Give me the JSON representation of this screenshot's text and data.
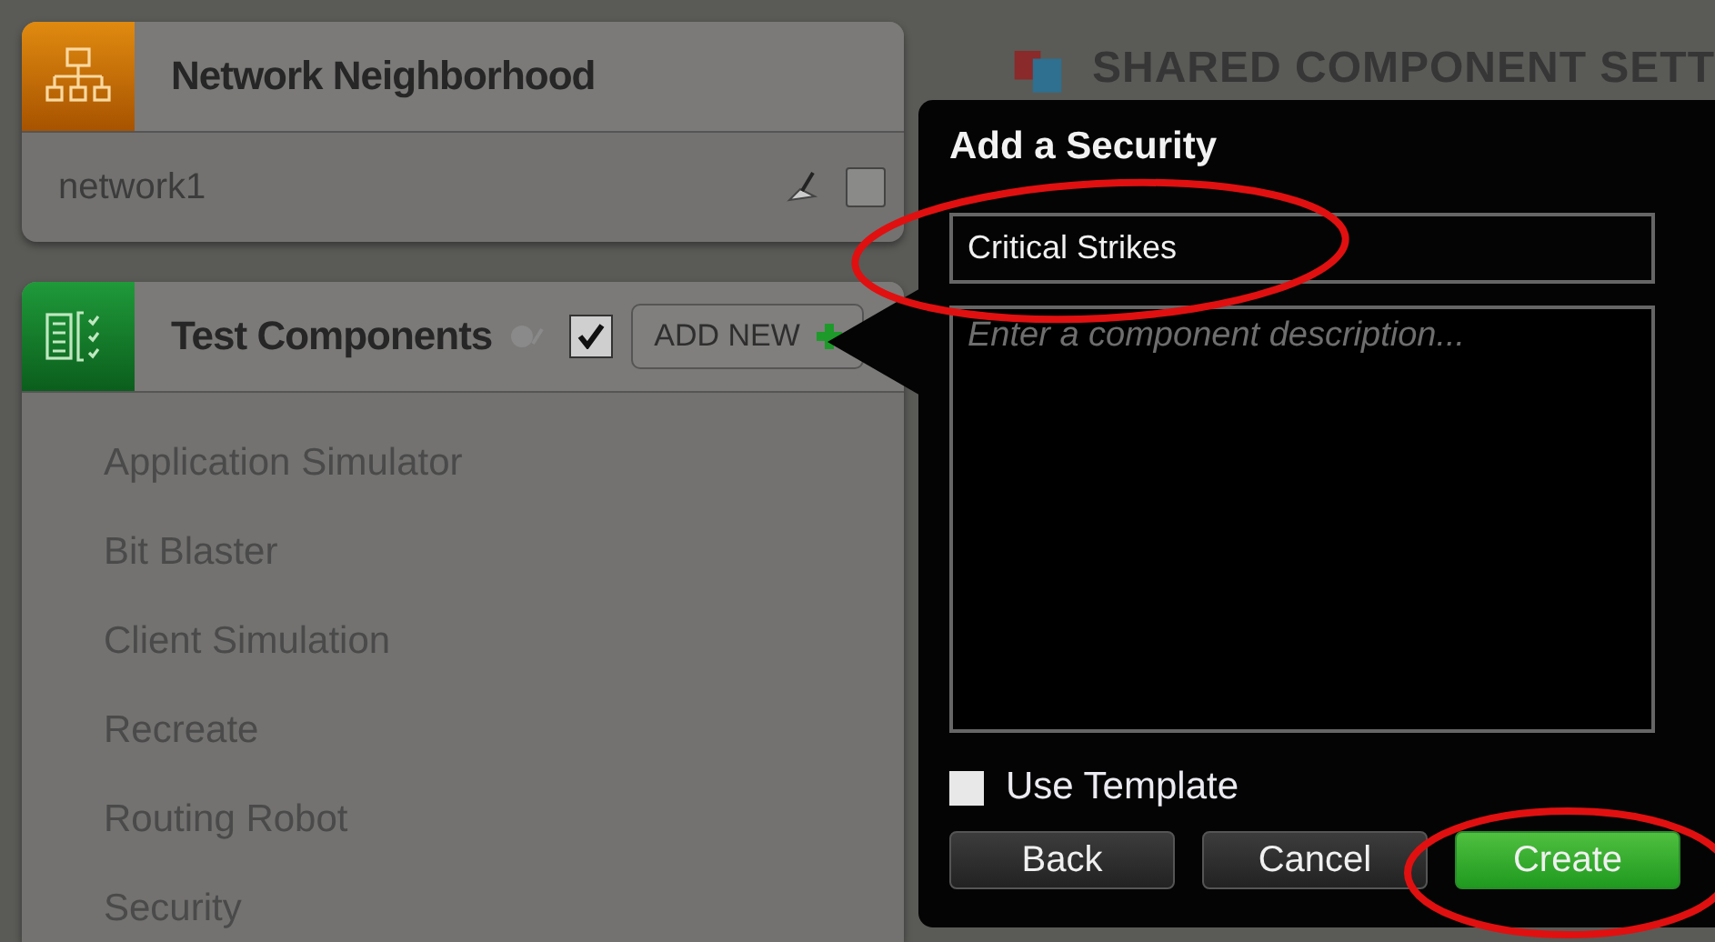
{
  "network": {
    "title": "Network Neighborhood",
    "items": [
      "network1"
    ]
  },
  "test_components": {
    "title": "Test Components",
    "checked": true,
    "add_button": "ADD NEW",
    "items": [
      "Application Simulator",
      "Bit Blaster",
      "Client Simulation",
      "Recreate",
      "Routing Robot",
      "Security"
    ]
  },
  "shared_settings": {
    "title": "SHARED COMPONENT SETT"
  },
  "dialog": {
    "title": "Add a Security",
    "name_value": "Critical Strikes",
    "description_placeholder": "Enter a component description...",
    "use_template": {
      "label": "Use Template",
      "checked": false
    },
    "buttons": [
      {
        "label": "Back",
        "kind": "default"
      },
      {
        "label": "Cancel",
        "kind": "default"
      },
      {
        "label": "Create",
        "kind": "primary"
      }
    ]
  }
}
